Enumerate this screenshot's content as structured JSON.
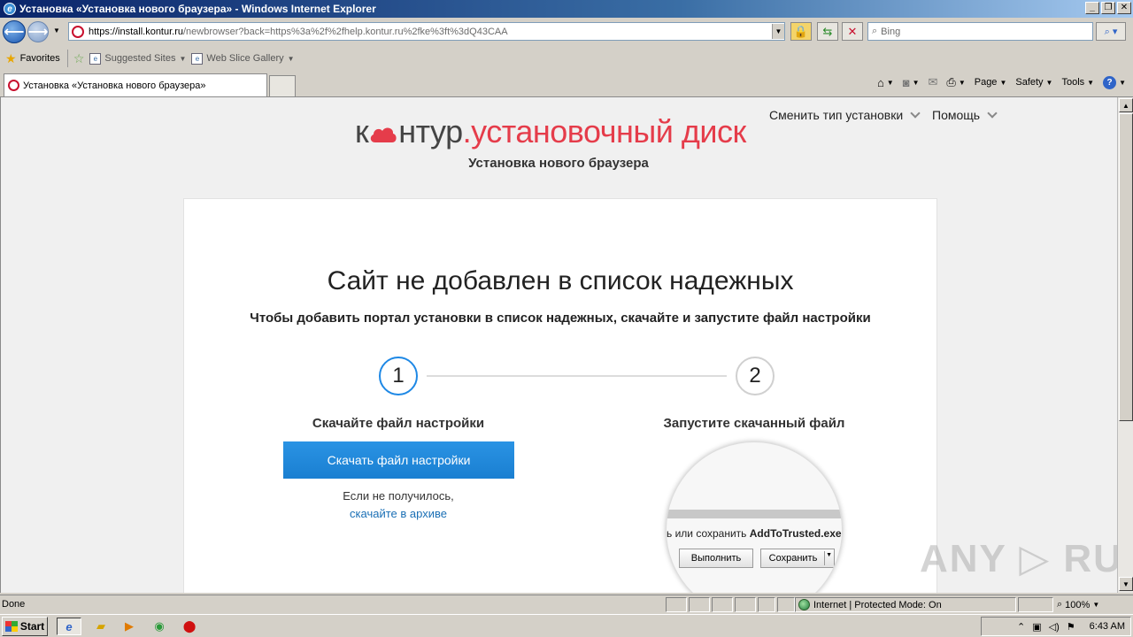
{
  "window": {
    "title": "Установка «Установка нового браузера» - Windows Internet Explorer",
    "minimize": "_",
    "restore": "❐",
    "close": "✕"
  },
  "address": {
    "url_host": "https://install.kontur.ru",
    "url_path": "/newbrowser?back=https%3a%2f%2fhelp.kontur.ru%2fke%3ft%3dQ43CAA",
    "search_placeholder": "Bing"
  },
  "favorites": {
    "label": "Favorites",
    "items": [
      {
        "label": "Suggested Sites"
      },
      {
        "label": "Web Slice Gallery"
      }
    ]
  },
  "tabs": [
    {
      "label": "Установка «Установка нового браузера»"
    }
  ],
  "commands": {
    "page": "Page",
    "safety": "Safety",
    "tools": "Tools"
  },
  "page": {
    "logo_left": "к",
    "logo_mid": "нтур",
    "logo_dot": ".",
    "logo_product": "установочный диск",
    "subtitle": "Установка нового браузера",
    "menu_change": "Сменить тип установки",
    "menu_help": "Помощь",
    "heading": "Сайт не добавлен в список надежных",
    "lead": "Чтобы добавить портал установки в список надежных, скачайте и запустите файл настройки",
    "step1_num": "1",
    "step2_num": "2",
    "step1_title": "Скачайте файл настройки",
    "step2_title": "Запустите скачанный файл",
    "download_button": "Скачать файл настройки",
    "fail_text": "Если не получилось,",
    "archive_link": "скачайте в архиве",
    "mag_text_prefix": "ь или сохранить ",
    "mag_text_file": "AddToTrusted.exe",
    "mag_run": "Выполнить",
    "mag_save": "Сохранить"
  },
  "watermark": "ANY ▷ RUN",
  "status": {
    "left": "Done",
    "zone": "Internet | Protected Mode: On",
    "zoom": "100%"
  },
  "taskbar": {
    "start": "Start",
    "clock": "6:43 AM"
  }
}
